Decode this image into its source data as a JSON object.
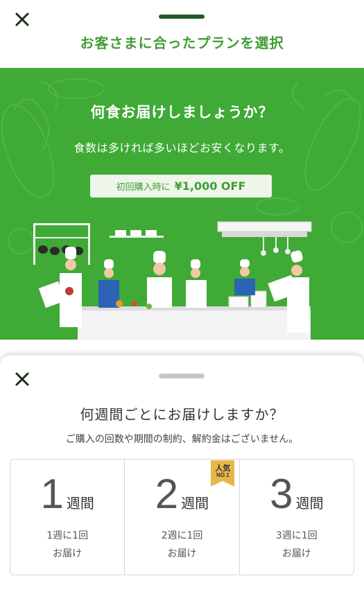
{
  "top": {
    "title": "お客さまに合ったプランを選択",
    "close_icon": "close-icon"
  },
  "hero": {
    "heading": "何食お届けしましょうか？",
    "subheading": "食数は多ければ多いほどお安くなります。",
    "promo_prefix": "初回購入時に",
    "promo_amount": "¥1,000 OFF",
    "background_color": "#3faa36"
  },
  "sheet": {
    "title": "何週間ごとにお届けしますか？",
    "subtitle": "ご購入の回数や期間の制約、解約金はございません。",
    "plans": [
      {
        "number": "1",
        "unit": "週間",
        "desc_line1": "1週に1回",
        "desc_line2": "お届け"
      },
      {
        "number": "2",
        "unit": "週間",
        "desc_line1": "2週に1回",
        "desc_line2": "お届け",
        "badge_line1": "人気",
        "badge_line2": "NO.1"
      },
      {
        "number": "3",
        "unit": "週間",
        "desc_line1": "3週に1回",
        "desc_line2": "お届け"
      }
    ]
  },
  "colors": {
    "accent_green": "#3f9e34",
    "badge_gold": "#e8b74a"
  }
}
